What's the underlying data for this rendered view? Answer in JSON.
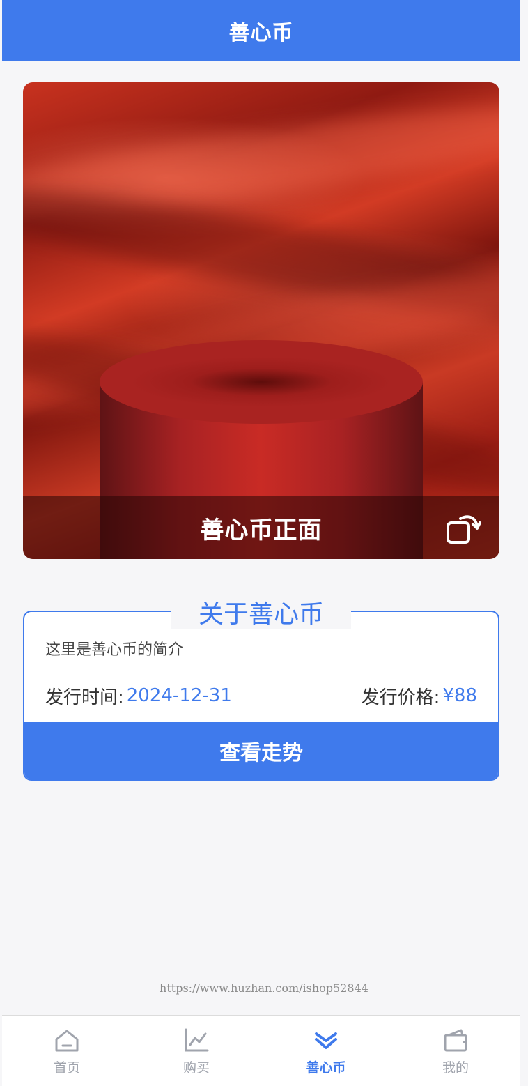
{
  "header": {
    "title": "善心币"
  },
  "coin_card": {
    "caption": "善心币正面",
    "flip_icon": "rotate-icon"
  },
  "about": {
    "title": "关于善心币",
    "intro": "这里是善心币的简介",
    "issue_time_label": "发行时间:",
    "issue_time_value": "2024-12-31",
    "issue_price_label": "发行价格:",
    "issue_price_value": "¥88",
    "trend_button": "查看走势"
  },
  "watermark": "https://www.huzhan.com/ishop52844",
  "tabbar": {
    "active_index": 2,
    "accent_color": "#3f7aec",
    "items": [
      {
        "label": "首页",
        "icon": "home-icon"
      },
      {
        "label": "购买",
        "icon": "chart-icon"
      },
      {
        "label": "善心币",
        "icon": "coin-icon"
      },
      {
        "label": "我的",
        "icon": "wallet-icon"
      }
    ]
  }
}
